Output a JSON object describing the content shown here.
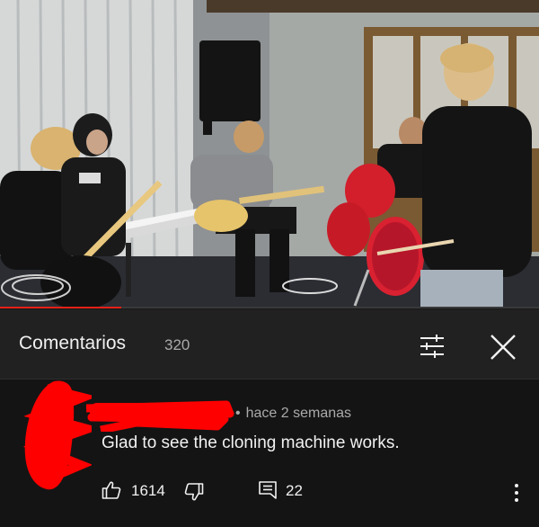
{
  "video": {
    "progress_fraction": 0.225,
    "progress_color": "#e62117"
  },
  "comments_header": {
    "title": "Comentarios",
    "count": "320",
    "sort_icon": "sort-filter-icon",
    "close_icon": "close-icon"
  },
  "comment": {
    "time": "hace 2 semanas",
    "text": "Glad to see the cloning machine works.",
    "likes": "1614",
    "replies": "22",
    "like_icon": "thumbs-up-icon",
    "dislike_icon": "thumbs-down-icon",
    "reply_icon": "reply-icon",
    "more_icon": "more-vertical-icon",
    "redaction_color": "#ff0000"
  }
}
